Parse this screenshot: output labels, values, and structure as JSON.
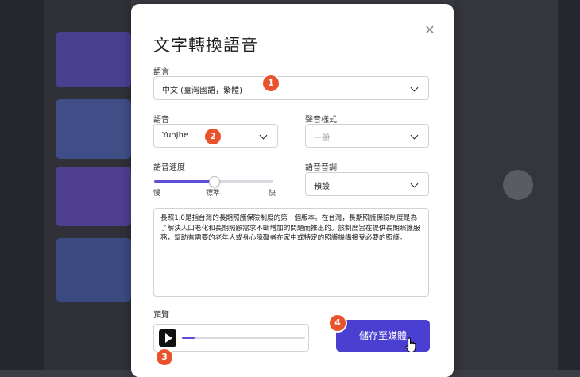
{
  "dialog": {
    "title": "文字轉換語音",
    "close_icon": "close-icon"
  },
  "language": {
    "label": "語言",
    "value": "中文 (臺灣國語，繁體)"
  },
  "voice": {
    "label": "語音",
    "value": "YunJhe"
  },
  "voice_style": {
    "label": "聲音樣式",
    "value": "一般"
  },
  "speed": {
    "label": "語音速度",
    "min_label": "慢",
    "mid_label": "標準",
    "max_label": "快",
    "value_fraction": 0.5
  },
  "pitch": {
    "label": "語音音調",
    "value": "預設"
  },
  "text_content": "長照1.0是指台灣的長期照護保險制度的第一個版本。在台灣，長期照護保險制度是為了解決人口老化和長期照顧需求不斷增加的問題而推出的。該制度旨在提供長期照護服務，幫助有需要的老年人或身心障礙者在家中或特定的照護機構接受必要的照護。",
  "preview": {
    "label": "預覽",
    "progress_fraction": 0.1
  },
  "save_button": {
    "label": "儲存至媒體"
  },
  "step_badges": [
    "1",
    "2",
    "3",
    "4"
  ],
  "colors": {
    "accent": "#4b3fd2",
    "badge": "#e8532b"
  }
}
